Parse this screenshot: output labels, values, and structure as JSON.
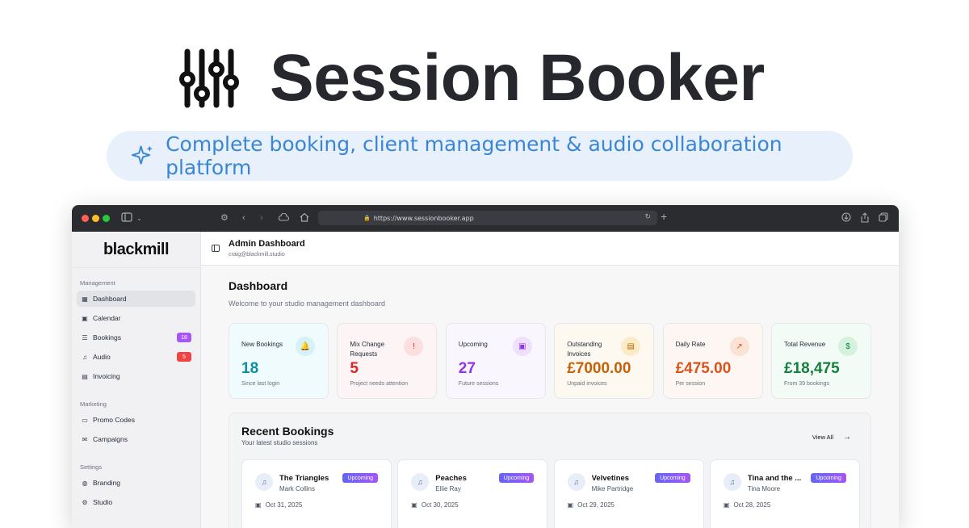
{
  "hero": {
    "title": "Session Booker",
    "tagline": "Complete booking, client management & audio collaboration platform"
  },
  "browser": {
    "url": "https://www.sessionbooker.app"
  },
  "sidebar": {
    "brand": "blackmill",
    "sections": [
      {
        "label": "Management",
        "items": [
          {
            "label": "Dashboard",
            "icon": "grid-icon",
            "active": true
          },
          {
            "label": "Calendar",
            "icon": "calendar-icon"
          },
          {
            "label": "Bookings",
            "icon": "list-icon",
            "badge": "18"
          },
          {
            "label": "Audio",
            "icon": "music-icon",
            "badge": "5"
          },
          {
            "label": "Invoicing",
            "icon": "document-icon"
          }
        ]
      },
      {
        "label": "Marketing",
        "items": [
          {
            "label": "Promo Codes",
            "icon": "ticket-icon"
          },
          {
            "label": "Campaigns",
            "icon": "mail-icon"
          }
        ]
      },
      {
        "label": "Settings",
        "items": [
          {
            "label": "Branding",
            "icon": "palette-icon"
          },
          {
            "label": "Studio",
            "icon": "gear-icon"
          }
        ]
      }
    ]
  },
  "topbar": {
    "title": "Admin Dashboard",
    "email": "craig@blackmill.studio"
  },
  "main": {
    "title": "Dashboard",
    "subtitle": "Welcome to your studio management dashboard"
  },
  "stats": [
    {
      "label": "New Bookings",
      "value": "18",
      "note": "Since last login",
      "icon": "bell-icon",
      "color": "#0d8f9f",
      "bg": "#f0fbfd",
      "icbg": "#d4f2f7"
    },
    {
      "label": "Mix Change Requests",
      "value": "5",
      "note": "Project needs attention",
      "icon": "alert-icon",
      "color": "#dc2626",
      "bg": "#fdf5f5",
      "icbg": "#fbdede"
    },
    {
      "label": "Upcoming",
      "value": "27",
      "note": "Future sessions",
      "icon": "calendar-icon",
      "color": "#9333ea",
      "bg": "#faf6fd",
      "icbg": "#efe0fb"
    },
    {
      "label": "Outstanding Invoices",
      "value": "£7000.00",
      "note": "Unpaid invoices",
      "icon": "document-icon",
      "color": "#c2620b",
      "bg": "#fdf9f1",
      "icbg": "#fbecc9"
    },
    {
      "label": "Daily Rate",
      "value": "£475.00",
      "note": "Per session",
      "icon": "trend-up-icon",
      "color": "#d9541c",
      "bg": "#fdf6f2",
      "icbg": "#fbe2d4"
    },
    {
      "label": "Total Revenue",
      "value": "£18,475",
      "note": "From 39 bookings",
      "icon": "dollar-icon",
      "color": "#15803d",
      "bg": "#f3fbf6",
      "icbg": "#d5f2df"
    }
  ],
  "recent": {
    "title": "Recent Bookings",
    "subtitle": "Your latest studio sessions",
    "view_all": "View All",
    "bookings": [
      {
        "name": "The Triangles",
        "client": "Mark Collins",
        "status": "Upcoming",
        "date": "Oct 31, 2025"
      },
      {
        "name": "Peaches",
        "client": "Ellie Ray",
        "status": "Upcoming",
        "date": "Oct 30, 2025"
      },
      {
        "name": "Velvetines",
        "client": "Mike Partridge",
        "status": "Upcoming",
        "date": "Oct 29, 2025"
      },
      {
        "name": "Tina and the ...",
        "client": "Tina Moore",
        "status": "Upcoming",
        "date": "Oct 28, 2025"
      }
    ]
  },
  "colors": {
    "badge_bookings": "#a855f7",
    "badge_audio": "#ef4444",
    "accent_blue": "#3a86d6"
  }
}
